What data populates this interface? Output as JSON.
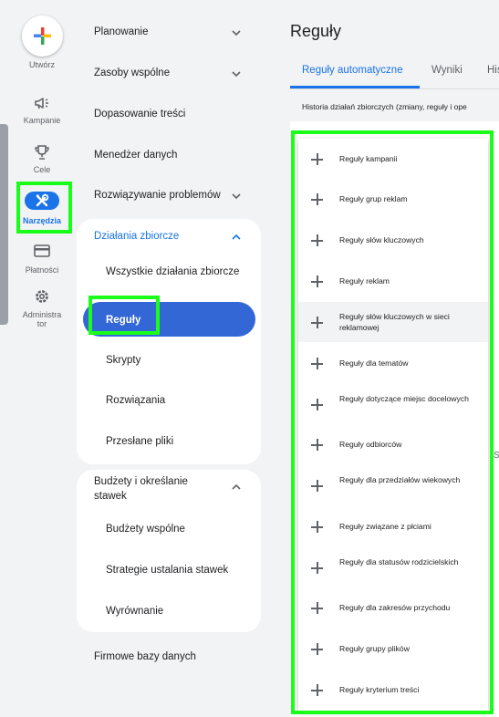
{
  "rail": {
    "create_label": "Utwórz",
    "items": [
      {
        "label": "Kampanie",
        "icon": "megaphone-icon"
      },
      {
        "label": "Cele",
        "icon": "trophy-icon"
      },
      {
        "label": "Narzędzia",
        "icon": "tools-icon",
        "active": true
      },
      {
        "label": "Płatności",
        "icon": "credit-card-icon"
      },
      {
        "label": "Administra\ntor",
        "icon": "gear-icon"
      }
    ]
  },
  "nav": {
    "sections": [
      {
        "label": "Planowanie"
      },
      {
        "label": "Zasoby wspólne"
      },
      {
        "label": "Dopasowanie treści"
      },
      {
        "label": "Menedżer danych"
      },
      {
        "label": "Rozwiązywanie problemów"
      }
    ],
    "bulk": {
      "label": "Działania zbiorcze",
      "items": [
        "Wszystkie działania zbiorcze",
        "Reguły",
        "Skrypty",
        "Rozwiązania",
        "Przesłane pliki"
      ],
      "active_index": 1
    },
    "budgets": {
      "label": "Budżety i określanie stawek",
      "items": [
        "Budżety wspólne",
        "Strategie ustalania stawek",
        "Wyrównanie"
      ]
    },
    "last": "Firmowe bazy danych"
  },
  "main": {
    "title": "Reguły",
    "tabs": [
      "Reguły automatyczne",
      "Wyniki",
      "His"
    ],
    "subheader": "Historia działań zbiorczych (zmiany, reguły i ope",
    "stray_char": "S"
  },
  "menu": {
    "items": [
      "Reguły kampanii",
      "Reguły grup reklam",
      "Reguły słów kluczowych",
      "Reguły reklam",
      "Reguły słów kluczowych w sieci reklamowej",
      "Reguły dla tematów",
      "Reguły dotyczące miejsc docelowych",
      "Reguły odbiorców",
      "Reguły dla przedziałów wiekowych",
      "Reguły związane z płciami",
      "Reguły dla statusów rodzicielskich",
      "Reguły dla zakresów przychodu",
      "Reguły grupy plików",
      "Reguły kryterium treści"
    ]
  },
  "colors": {
    "accent": "#1a73e8",
    "active_pill": "#3367d6",
    "highlight": "#1aff1a"
  }
}
